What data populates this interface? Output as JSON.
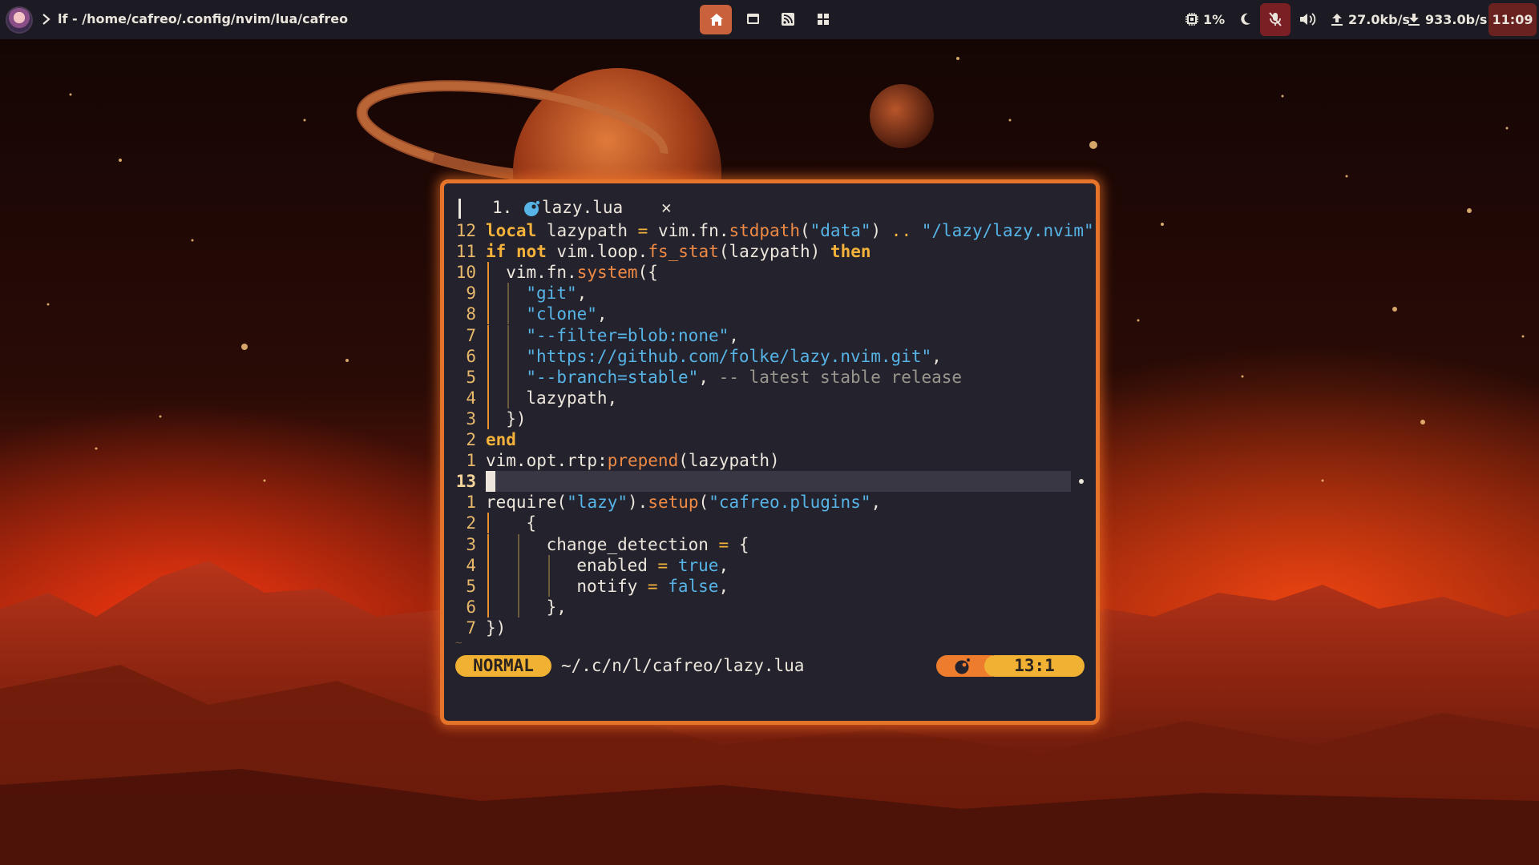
{
  "topbar": {
    "path": "lf - /home/cafreo/.config/nvim/lua/cafreo",
    "workspaces": [
      {
        "icon": "home-icon",
        "active": true
      },
      {
        "icon": "browser-icon",
        "active": false
      },
      {
        "icon": "rss-icon",
        "active": false
      },
      {
        "icon": "windows-icon",
        "active": false
      }
    ],
    "cpu": "1%",
    "upload": "27.0kb/s",
    "download": "933.0b/s",
    "clock": "11:09"
  },
  "editor": {
    "tab": {
      "number": "1.",
      "filename": "lazy.lua",
      "close": "✕"
    },
    "line_numbers": [
      "12",
      "11",
      "10",
      "9",
      "8",
      "7",
      "6",
      "5",
      "4",
      "3",
      "2",
      "1",
      "13",
      "1",
      "2",
      "3",
      "4",
      "5",
      "6",
      "7"
    ],
    "code": {
      "l0": [
        "local",
        " lazypath ",
        "=",
        " vim.fn.",
        "stdpath",
        "(",
        "\"data\"",
        ") ",
        "..",
        " ",
        "\"/lazy/lazy.nvim\""
      ],
      "l1": [
        "if",
        " ",
        "not",
        " vim.loop.",
        "fs_stat",
        "(lazypath) ",
        "then"
      ],
      "l2": [
        "vim.fn.",
        "system",
        "({"
      ],
      "l3": [
        "\"git\"",
        ","
      ],
      "l4": [
        "\"clone\"",
        ","
      ],
      "l5": [
        "\"--filter=blob:none\"",
        ","
      ],
      "l6": [
        "\"https://github.com/folke/lazy.nvim.git\"",
        ","
      ],
      "l7": [
        "\"--branch=stable\"",
        ", ",
        "-- latest stable release"
      ],
      "l8": [
        "lazypath,"
      ],
      "l9": [
        "})"
      ],
      "l10": [
        "end"
      ],
      "l11": [
        "vim.opt.rtp:",
        "prepend",
        "(lazypath)"
      ],
      "l13": [
        "require(",
        "\"lazy\"",
        ").",
        "setup",
        "(",
        "\"cafreo.plugins\"",
        ","
      ],
      "l14": [
        "{"
      ],
      "l15": [
        "change_detection ",
        "=",
        " {"
      ],
      "l16": [
        "enabled ",
        "=",
        " ",
        "true",
        ","
      ],
      "l17": [
        "notify ",
        "=",
        " ",
        "false",
        ","
      ],
      "l18": [
        "},"
      ],
      "l19": [
        "})"
      ]
    },
    "tilde": "~",
    "statusline": {
      "mode": "NORMAL",
      "filepath": "~/.c/n/l/cafreo/lazy.lua",
      "position": "13:1"
    }
  },
  "colors": {
    "accent": "#e5742a",
    "mode_bg": "#f1b133",
    "keyword": "#f4b23a",
    "string": "#56b4e6",
    "function": "#ef8a45"
  }
}
